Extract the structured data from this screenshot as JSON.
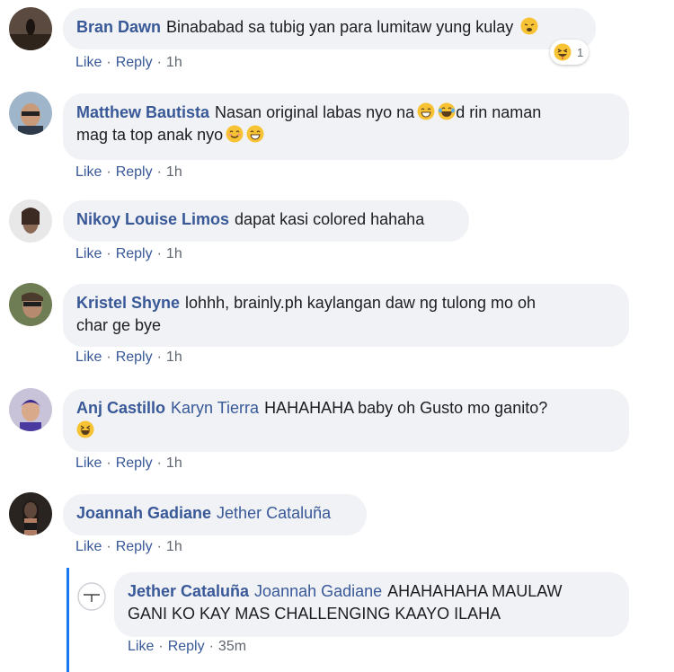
{
  "comments": [
    {
      "author": "Bran Dawn",
      "tag": "",
      "text": "Binababad sa tubig yan para lumitaw yung kulay",
      "like": "Like",
      "reply": "Reply",
      "time": "1h",
      "reaction_count": "1"
    },
    {
      "author": "Matthew Bautista",
      "tag": "",
      "text": "Nasan original labas nyo na",
      "text2": "d rin naman",
      "text3": "mag ta top anak nyo",
      "like": "Like",
      "reply": "Reply",
      "time": "1h"
    },
    {
      "author": "Nikoy Louise Limos",
      "tag": "",
      "text": "dapat kasi colored hahaha",
      "like": "Like",
      "reply": "Reply",
      "time": "1h"
    },
    {
      "author": "Kristel Shyne",
      "tag": "",
      "text": "lohhh, brainly.ph kaylangan daw ng tulong mo oh",
      "text2": "char ge bye",
      "like": "Like",
      "reply": "Reply",
      "time": "1h"
    },
    {
      "author": "Anj Castillo",
      "tag": "Karyn Tierra",
      "text": "HAHAHAHA baby oh Gusto mo ganito?",
      "like": "Like",
      "reply": "Reply",
      "time": "1h"
    },
    {
      "author": "Joannah Gadiane",
      "tag": "Jether Cataluña",
      "text": "",
      "like": "Like",
      "reply": "Reply",
      "time": "1h"
    }
  ],
  "reply": {
    "author": "Jether Cataluña",
    "tag": "Joannah Gadiane",
    "text": "AHAHAHAHA MAULAW",
    "text2": "GANI KO KAY MAS CHALLENGING KAAYO ILAHA",
    "like": "Like",
    "reply": "Reply",
    "time": "35m"
  },
  "colors": {
    "name": "#385898",
    "bubble": "#f0f2f5",
    "thread": "#1877f2",
    "meta": "#606770"
  }
}
